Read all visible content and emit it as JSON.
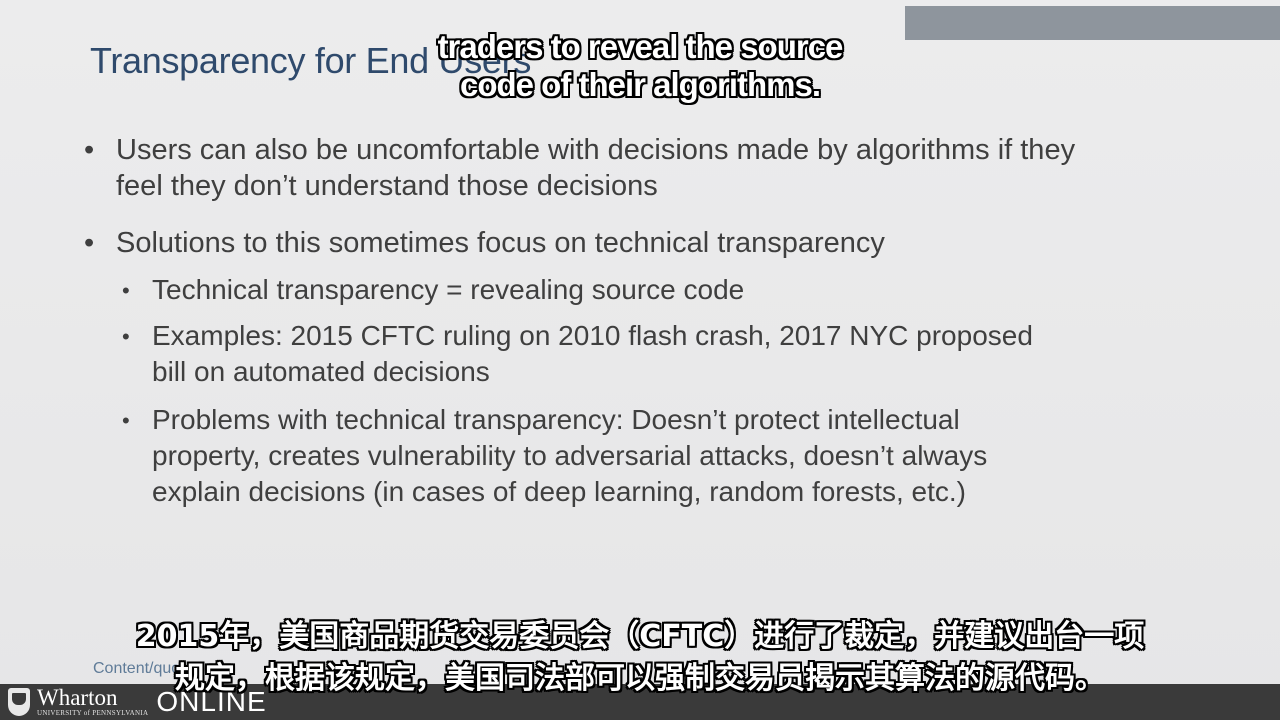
{
  "slide": {
    "title": "Transparency for End Users",
    "bullet_marker": "•",
    "bullets": [
      {
        "lines": [
          "Users can also be uncomfortable with decisions made by algorithms if they",
          "feel they don’t understand those decisions"
        ]
      },
      {
        "lines": [
          "Solutions to this sometimes focus on technical transparency"
        ],
        "sub": [
          {
            "lines": [
              "Technical transparency = revealing source code"
            ]
          },
          {
            "lines": [
              "Examples: 2015 CFTC ruling on 2010 flash crash, 2017 NYC proposed",
              "bill on automated decisions"
            ]
          },
          {
            "lines": [
              "Problems with technical transparency: Doesn’t protect intellectual",
              "property, creates vulnerability to adversarial attacks, doesn’t always",
              "explain decisions (in cases of deep learning, random forests, etc.)"
            ]
          }
        ]
      }
    ],
    "footer_source": "Content/quotes"
  },
  "branding": {
    "wharton": "Wharton",
    "university": "UNIVERSITY of PENNSYLVANIA",
    "online": "ONLINE"
  },
  "captions": {
    "english": [
      "traders to reveal the source",
      "code of their algorithms."
    ],
    "chinese": [
      "2015年，美国商品期货交易委员会（CFTC）进行了裁定，并建议出台一项",
      "规定，根据该规定，美国司法部可以强制交易员揭示其算法的源代码。"
    ]
  },
  "colors": {
    "title": "#2f4a6c",
    "body_text": "#3f3f3f",
    "footer_text": "#5f7b98",
    "footer_bar": "#3a3a3a",
    "top_band": "#8e959d"
  }
}
